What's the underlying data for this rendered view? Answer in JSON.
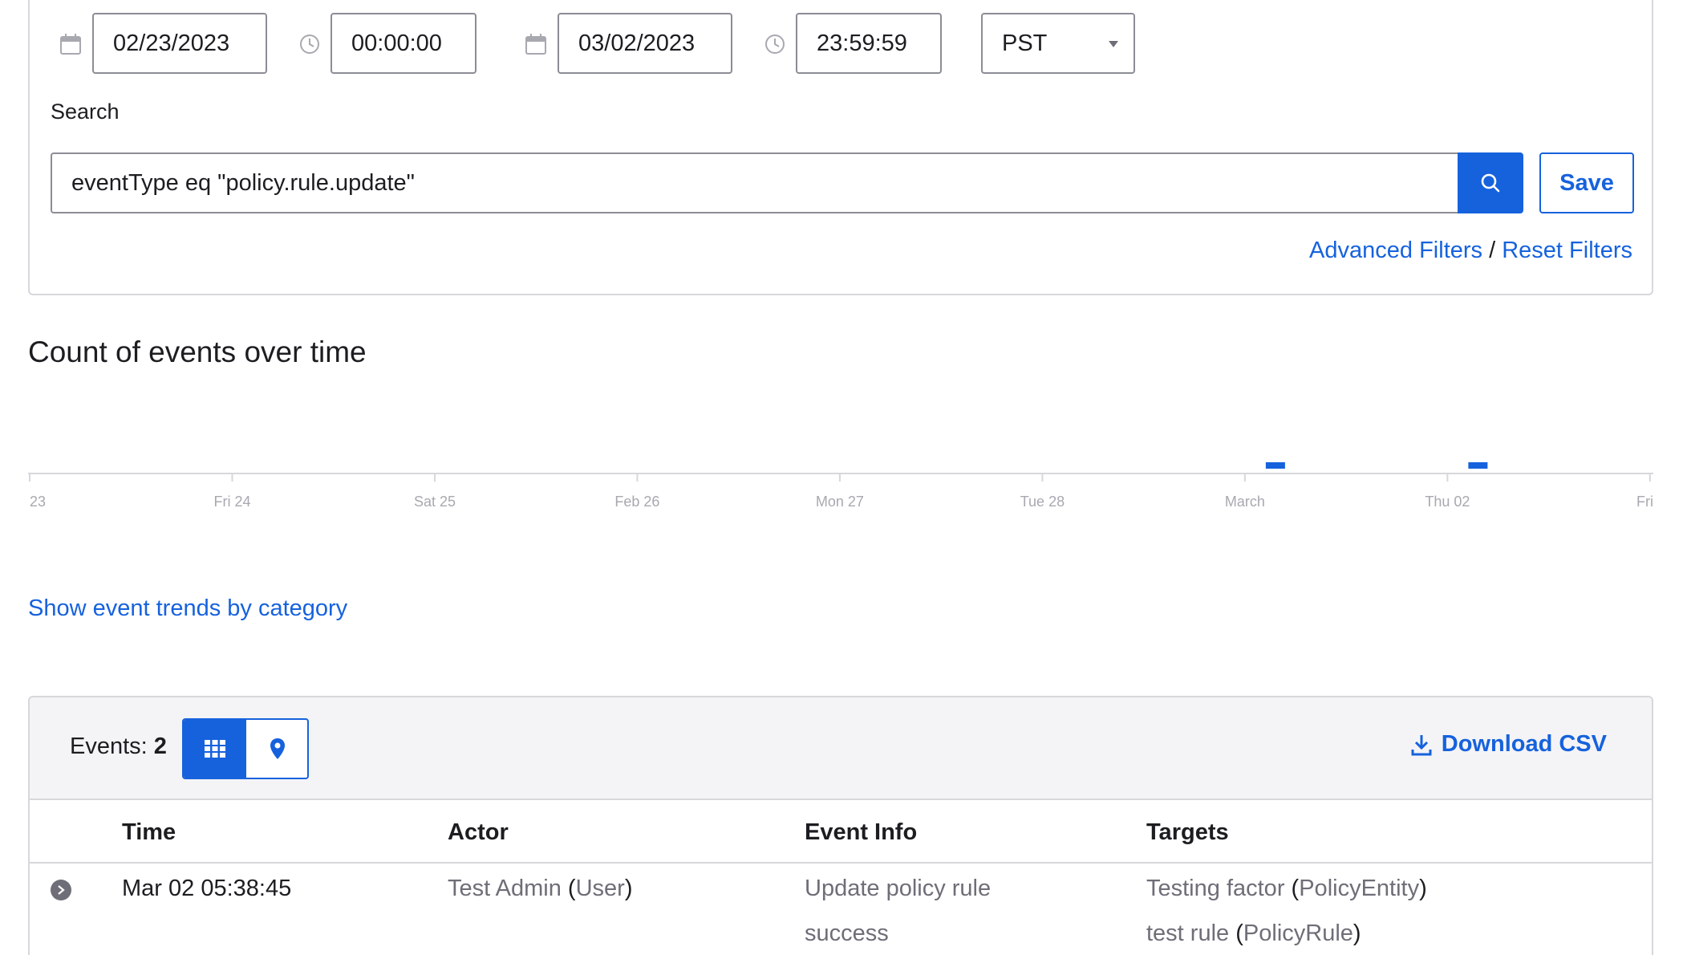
{
  "filters": {
    "start_date": "02/23/2023",
    "start_time": "00:00:00",
    "end_date": "03/02/2023",
    "end_time": "23:59:59",
    "timezone": "PST",
    "search_label": "Search",
    "search_value": "eventType eq \"policy.rule.update\"",
    "save_label": "Save",
    "advanced_filters": "Advanced Filters",
    "separator": "/",
    "reset_filters": "Reset Filters"
  },
  "chart_title": "Count of events over time",
  "chart_data": {
    "type": "bar",
    "title": "Count of events over time",
    "x_tick_labels": [
      "23",
      "Fri 24",
      "Sat 25",
      "Feb 26",
      "Mon 27",
      "Tue 28",
      "March",
      "Thu 02",
      "Fri"
    ],
    "x": [
      "March",
      "Thu 02"
    ],
    "values": [
      1,
      1
    ],
    "xlabel": "",
    "ylabel": "",
    "grid": false,
    "bar_color": "#1662dd"
  },
  "trends_link": "Show event trends by category",
  "events": {
    "count_label": "Events:",
    "count": "2",
    "download_label": "Download CSV",
    "columns": [
      "Time",
      "Actor",
      "Event Info",
      "Targets"
    ],
    "rows": [
      {
        "time": "Mar 02 05:38:45",
        "actor": "Test Admin",
        "actor_type_open": "(",
        "actor_type": "User",
        "actor_type_close": ")",
        "event_info": "Update policy rule",
        "outcome": "success",
        "targets": [
          {
            "name": "Testing factor",
            "type_open": "(",
            "type": "PolicyEntity",
            "type_close": ")"
          },
          {
            "name": "test rule",
            "type_open": "(",
            "type": "PolicyRule",
            "type_close": ")"
          }
        ]
      }
    ]
  },
  "colors": {
    "accent": "#1662dd",
    "border": "#d7d7dc",
    "muted_text": "#6e6e78"
  }
}
